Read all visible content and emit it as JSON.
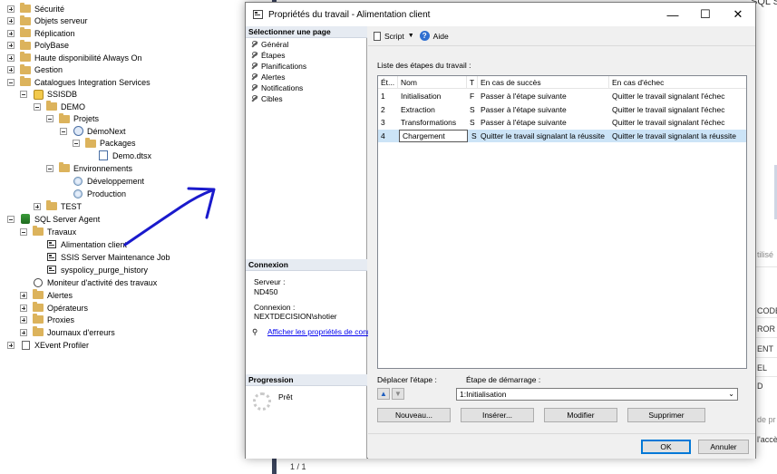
{
  "tree": {
    "nodes": [
      {
        "label": "Sécurité",
        "expander": "plus",
        "icon": "folder"
      },
      {
        "label": "Objets serveur",
        "expander": "plus",
        "icon": "folder"
      },
      {
        "label": "Réplication",
        "expander": "plus",
        "icon": "folder"
      },
      {
        "label": "PolyBase",
        "expander": "plus",
        "icon": "folder"
      },
      {
        "label": "Haute disponibilité Always On",
        "expander": "plus",
        "icon": "folder"
      },
      {
        "label": "Gestion",
        "expander": "plus",
        "icon": "folder"
      },
      {
        "label": "Catalogues Integration Services",
        "expander": "minus",
        "icon": "folder"
      },
      {
        "label": "SSISDB",
        "expander": "minus",
        "icon": "ssis-catalog-icon"
      },
      {
        "label": "DEMO",
        "expander": "minus",
        "icon": "folder"
      },
      {
        "label": "Projets",
        "expander": "minus",
        "icon": "folder"
      },
      {
        "label": "DémoNext",
        "expander": "minus",
        "icon": "ssis-project-icon"
      },
      {
        "label": "Packages",
        "expander": "minus",
        "icon": "folder"
      },
      {
        "label": "Demo.dtsx",
        "expander": "none",
        "icon": "package-icon"
      },
      {
        "label": "Environnements",
        "expander": "minus",
        "icon": "folder"
      },
      {
        "label": "Développement",
        "expander": "none",
        "icon": "environment-icon"
      },
      {
        "label": "Production",
        "expander": "none",
        "icon": "environment-icon"
      },
      {
        "label": "TEST",
        "expander": "plus",
        "icon": "folder"
      },
      {
        "label": "SQL Server Agent",
        "expander": "minus",
        "icon": "sql-agent-icon"
      },
      {
        "label": "Travaux",
        "expander": "minus",
        "icon": "folder"
      },
      {
        "label": "Alimentation client",
        "expander": "none",
        "icon": "job-icon"
      },
      {
        "label": "SSIS Server Maintenance Job",
        "expander": "none",
        "icon": "job-icon"
      },
      {
        "label": "syspolicy_purge_history",
        "expander": "none",
        "icon": "job-icon"
      },
      {
        "label": "Moniteur d'activité des travaux",
        "expander": "none",
        "icon": "job-activity-icon"
      },
      {
        "label": "Alertes",
        "expander": "plus",
        "icon": "folder"
      },
      {
        "label": "Opérateurs",
        "expander": "plus",
        "icon": "folder"
      },
      {
        "label": "Proxies",
        "expander": "plus",
        "icon": "folder"
      },
      {
        "label": "Journaux d'erreurs",
        "expander": "plus",
        "icon": "folder"
      },
      {
        "label": "XEvent Profiler",
        "expander": "plus",
        "icon": "xevent-icon"
      }
    ]
  },
  "background": {
    "right_fragments": [
      "SQL S",
      "tilisé",
      "CODE",
      "ROR",
      "ENT",
      "EL",
      "D",
      "de pr",
      "l'accè"
    ],
    "page_indicator": "1 / 1"
  },
  "dialog": {
    "title": "Propriétés du travail - Alimentation client",
    "window_controls": {
      "minimize": "—",
      "maximize": "☐",
      "close": "✕"
    },
    "select_page_header": "Sélectionner une page",
    "pages": [
      "Général",
      "Étapes",
      "Planifications",
      "Alertes",
      "Notifications",
      "Cibles"
    ],
    "connection": {
      "header": "Connexion",
      "server_label": "Serveur :",
      "server_value": "ND450",
      "connection_label": "Connexion :",
      "connection_value": "NEXTDECISION\\shotier",
      "link": "Afficher les propriétés de conn"
    },
    "progress": {
      "header": "Progression",
      "status": "Prêt"
    },
    "toolbar": {
      "script": "Script",
      "help": "Aide"
    },
    "steps_list_label": "Liste des étapes du travail :",
    "grid": {
      "columns": [
        "Ét...",
        "Nom",
        "T",
        "En cas de succès",
        "En cas d'échec"
      ],
      "rows": [
        {
          "step": "1",
          "name": "Initialisation",
          "type": "F",
          "on_success": "Passer à l'étape suivante",
          "on_failure": "Quitter le travail signalant l'échec"
        },
        {
          "step": "2",
          "name": "Extraction",
          "type": "S",
          "on_success": "Passer à l'étape suivante",
          "on_failure": "Quitter le travail signalant l'échec"
        },
        {
          "step": "3",
          "name": "Transformations",
          "type": "S",
          "on_success": "Passer à l'étape suivante",
          "on_failure": "Quitter le travail signalant l'échec"
        },
        {
          "step": "4",
          "name": "Chargement",
          "type": "S",
          "on_success": "Quitter le travail signalant la réussite",
          "on_failure": "Quitter le travail signalant la réussite"
        }
      ]
    },
    "move_step_label": "Déplacer l'étape :",
    "start_step_label": "Étape de démarrage :",
    "start_step_value": "1:Initialisation",
    "buttons": {
      "new": "Nouveau...",
      "insert": "Insérer...",
      "modify": "Modifier",
      "delete": "Supprimer",
      "ok": "OK",
      "cancel": "Annuler"
    }
  },
  "colors": {
    "selection": "#cce4f7",
    "annotation_arrow": "#1a1acc",
    "folder": "#dcb35c",
    "accent": "#0078d7"
  }
}
